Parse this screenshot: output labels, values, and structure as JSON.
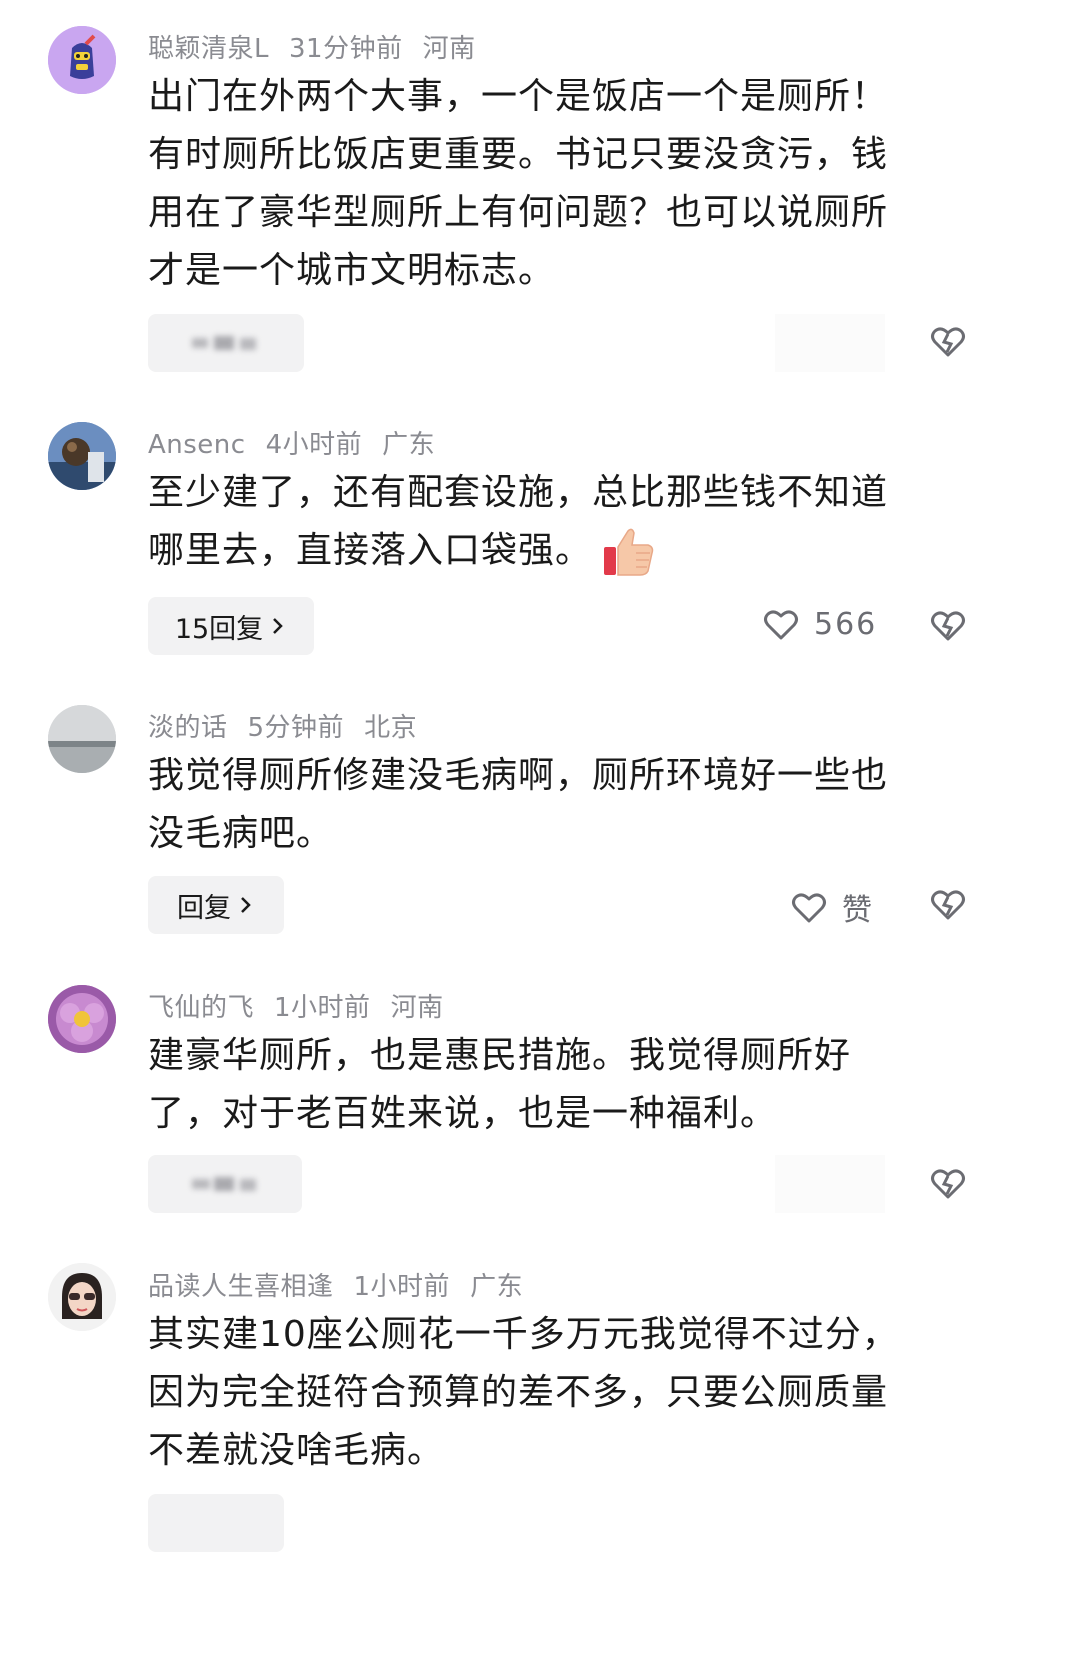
{
  "comments": [
    {
      "username": "聪颖清泉L",
      "time": "31分钟前",
      "location": "河南",
      "lines": [
        "出门在外两个大事，一个是饭店一个是厕所！",
        "有时厕所比饭店更重要。书记只要没贪污，钱",
        "用在了豪华型厕所上有何问题？也可以说厕所",
        "才是一个城市文明标志。"
      ],
      "avatar_icon": "cartoon-character-avatar"
    },
    {
      "username": "Ansenc",
      "time": "4小时前",
      "location": "广东",
      "lines": [
        "至少建了，还有配套设施，总比那些钱不知道",
        "哪里去，直接落入口袋强。"
      ],
      "emoji": "thumbs-up",
      "reply_label": "15回复",
      "likes": "566",
      "avatar_icon": "ball-photo-avatar"
    },
    {
      "username": "淡的话",
      "time": "5分钟前",
      "location": "北京",
      "lines": [
        "我觉得厕所修建没毛病啊，厕所环境好一些也",
        "没毛病吧。"
      ],
      "reply_label": "回复",
      "likes": "赞",
      "avatar_icon": "landscape-photo-avatar"
    },
    {
      "username": "飞仙的飞",
      "time": "1小时前",
      "location": "河南",
      "lines": [
        "建豪华厕所，也是惠民措施。我觉得厕所好",
        "了，对于老百姓来说，也是一种福利。"
      ],
      "avatar_icon": "flower-photo-avatar"
    },
    {
      "username": "品读人生喜相逢",
      "time": "1小时前",
      "location": "广东",
      "lines": [
        "其实建10座公厕花一千多万元我觉得不过分，",
        "因为完全挺符合预算的差不多，只要公厕质量",
        "不差就没啥毛病。"
      ],
      "avatar_icon": "woman-sunglasses-avatar"
    }
  ],
  "icons": {
    "heart": "heart-icon",
    "dislike": "broken-heart-icon",
    "chevron": "chevron-right-icon"
  },
  "colors": {
    "meta": "#8a8b91",
    "text": "#1a1a1a",
    "button_bg": "#f2f2f3",
    "icon": "#6b6c72"
  }
}
